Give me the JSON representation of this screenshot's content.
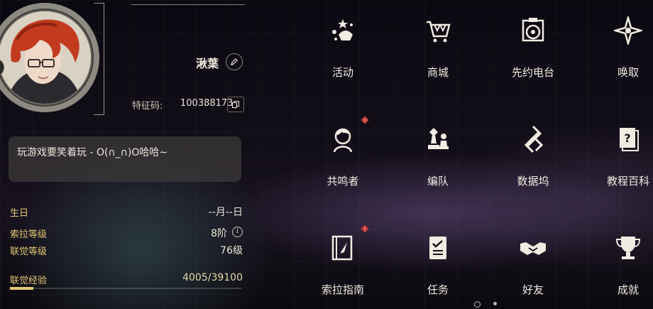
{
  "profile": {
    "name": "湫葉",
    "uid_label": "特征码:",
    "uid_value": "100388173",
    "signature": "玩游戏要笑着玩 - O(∩_∩)O哈哈~",
    "more_icon": "more-dots-icon",
    "edit_icon": "pencil-icon",
    "copy_icon": "copy-icon"
  },
  "stats": [
    {
      "label": "生日",
      "value": "--月--日"
    },
    {
      "label": "索拉等级",
      "value": "8阶"
    },
    {
      "label": "联觉等级",
      "value": "76级"
    },
    {
      "label": "联觉经验",
      "value": "4005/39100"
    }
  ],
  "exp_progress": 0.1024,
  "menu": [
    {
      "label": "活动",
      "icon": "fireworks-icon",
      "badge": false
    },
    {
      "label": "商城",
      "icon": "shopping-cart-icon",
      "badge": false
    },
    {
      "label": "先约电台",
      "icon": "radio-record-icon",
      "badge": false
    },
    {
      "label": "唤取",
      "icon": "compass-star-icon",
      "badge": false
    },
    {
      "label": "共鸣者",
      "icon": "resonator-portrait-icon",
      "badge": true
    },
    {
      "label": "编队",
      "icon": "chess-pieces-icon",
      "badge": false
    },
    {
      "label": "数据坞",
      "icon": "data-dock-icon",
      "badge": false
    },
    {
      "label": "教程百科",
      "icon": "tutorial-book-icon",
      "badge": false
    },
    {
      "label": "索拉指南",
      "icon": "guide-book-icon",
      "badge": true
    },
    {
      "label": "任务",
      "icon": "task-list-icon",
      "badge": false
    },
    {
      "label": "好友",
      "icon": "handshake-icon",
      "badge": false
    },
    {
      "label": "成就",
      "icon": "trophy-icon",
      "badge": false
    }
  ],
  "colors": {
    "accent_gold": "#e5c876",
    "badge_red": "#c23a3a",
    "text": "#f1ece2"
  },
  "pager": {
    "pages": 2,
    "current": 1
  }
}
